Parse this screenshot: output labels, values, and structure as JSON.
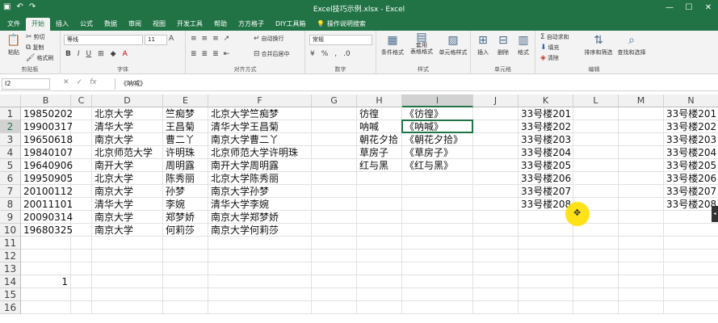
{
  "window": {
    "title": "Excel技巧示例.xlsx - Excel"
  },
  "tabs": [
    "文件",
    "开始",
    "插入",
    "公式",
    "数据",
    "审阅",
    "视图",
    "开发工具",
    "帮助",
    "方方格子",
    "DIY工具箱"
  ],
  "tell_me": "操作说明搜索",
  "ribbon": {
    "clipboard": {
      "label": "剪贴板",
      "paste": "粘贴",
      "cut": "剪切",
      "copy": "复制",
      "format_painter": "格式刷"
    },
    "font": {
      "label": "字体",
      "name": "等线",
      "size": "11"
    },
    "alignment": {
      "label": "对齐方式",
      "wrap": "自动换行",
      "merge": "合并后居中"
    },
    "number": {
      "label": "数字",
      "format": "常规"
    },
    "styles": {
      "label": "样式",
      "cond": "条件格式",
      "table": "套用\n表格格式",
      "cell": "单元格样式"
    },
    "cells": {
      "label": "单元格",
      "insert": "插入",
      "delete": "删除",
      "format": "格式"
    },
    "editing": {
      "label": "编辑",
      "autosum": "自动求和",
      "fill": "填充",
      "clear": "清除",
      "sort": "排序和筛选",
      "find": "查找和选择"
    }
  },
  "formula_bar": {
    "name_box": "I2",
    "formula": "《呐喊》"
  },
  "columns": [
    "B",
    "C",
    "D",
    "E",
    "F",
    "G",
    "H",
    "I",
    "J",
    "K",
    "L",
    "M",
    "N"
  ],
  "rows": [
    "1",
    "2",
    "3",
    "4",
    "5",
    "6",
    "7",
    "8",
    "9",
    "10",
    "11",
    "12",
    "13",
    "14",
    "15",
    "16"
  ],
  "cells": {
    "B": [
      "19850202",
      "19900317",
      "19650618",
      "19840107",
      "19640906",
      "19950905",
      "20100112",
      "20011101",
      "20090314",
      "19680325",
      "",
      "",
      "",
      "1",
      "",
      ""
    ],
    "D": [
      "北京大学",
      "清华大学",
      "南京大学",
      "北京师范大学",
      "南开大学",
      "北京大学",
      "南京大学",
      "清华大学",
      "南京大学",
      "南京大学",
      "",
      "",
      "",
      "",
      "",
      ""
    ],
    "E": [
      "竺痴梦",
      "王昌菊",
      "曹二丫",
      "许明珠",
      "周明露",
      "陈秀丽",
      "孙梦",
      "李婉",
      "郑梦娇",
      "何莉莎",
      "",
      "",
      "",
      "",
      "",
      ""
    ],
    "F": [
      "北京大学竺痴梦",
      "清华大学王昌菊",
      "南京大学曹二丫",
      "北京师范大学许明珠",
      "南开大学周明露",
      "北京大学陈秀丽",
      "南京大学孙梦",
      "清华大学李婉",
      "南京大学郑梦娇",
      "南京大学何莉莎",
      "",
      "",
      "",
      "",
      "",
      ""
    ],
    "H": [
      "彷徨",
      "呐喊",
      "朝花夕拾",
      "草房子",
      "红与黑",
      "",
      "",
      "",
      "",
      "",
      "",
      "",
      "",
      "",
      "",
      ""
    ],
    "I": [
      "《彷徨》",
      "《呐喊》",
      "《朝花夕拾》",
      "《草房子》",
      "《红与黑》",
      "",
      "",
      "",
      "",
      "",
      "",
      "",
      "",
      "",
      "",
      ""
    ],
    "K": [
      "33号楼201",
      "33号楼202",
      "33号楼203",
      "33号楼204",
      "33号楼205",
      "33号楼206",
      "33号楼207",
      "33号楼208",
      "",
      "",
      "",
      "",
      "",
      "",
      "",
      ""
    ],
    "N": [
      "33号楼201",
      "33号楼202",
      "33号楼203",
      "33号楼204",
      "33号楼205",
      "33号楼206",
      "33号楼207",
      "33号楼208",
      "",
      "",
      "",
      "",
      "",
      "",
      "",
      ""
    ]
  },
  "right_aligned_rows": {
    "B14": true
  },
  "colors": {
    "accent": "#217346",
    "cursor": "#ffe000"
  }
}
